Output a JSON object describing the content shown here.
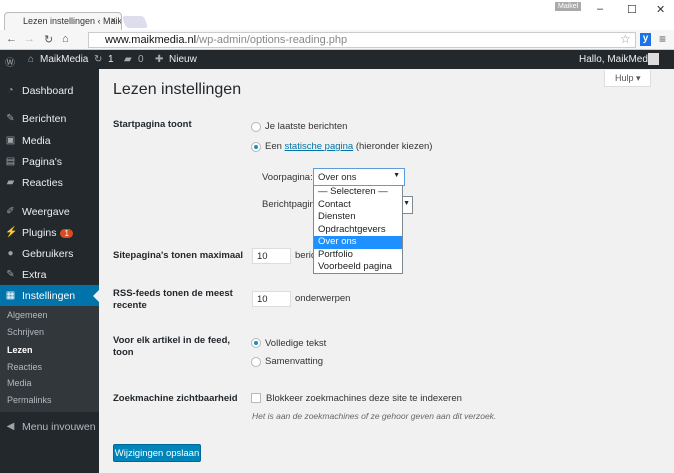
{
  "browser": {
    "tab_title": "Lezen instellingen ‹ Maik",
    "tab_close": "×",
    "profile": "Maikel",
    "url_domain": "www.maikmedia.nl",
    "url_path": "/wp-admin/options-reading.php",
    "ext": "y"
  },
  "adminbar": {
    "site": "MaikMedia",
    "updates": "1",
    "comments": "0",
    "new": "Nieuw",
    "greeting": "Hallo, MaikMedia"
  },
  "sidebar": {
    "items": [
      {
        "label": "Dashboard",
        "icon": "dashboard-icon",
        "glyph": "◔"
      },
      {
        "label": "Berichten",
        "icon": "pin-icon",
        "glyph": "✎"
      },
      {
        "label": "Media",
        "icon": "media-icon",
        "glyph": "▣"
      },
      {
        "label": "Pagina's",
        "icon": "pages-icon",
        "glyph": "▤"
      },
      {
        "label": "Reacties",
        "icon": "comments-icon",
        "glyph": "▰"
      },
      {
        "label": "Weergave",
        "icon": "brush-icon",
        "glyph": "✐"
      },
      {
        "label": "Plugins",
        "icon": "plugin-icon",
        "glyph": "⚡",
        "badge": "1"
      },
      {
        "label": "Gebruikers",
        "icon": "users-icon",
        "glyph": "●"
      },
      {
        "label": "Extra",
        "icon": "tools-icon",
        "glyph": "✎"
      },
      {
        "label": "Instellingen",
        "icon": "settings-icon",
        "glyph": "▦"
      }
    ],
    "submenu": [
      "Algemeen",
      "Schrijven",
      "Lezen",
      "Reacties",
      "Media",
      "Permalinks"
    ],
    "collapse": "Menu invouwen"
  },
  "page": {
    "title": "Lezen instellingen",
    "help": "Hulp ▾",
    "front": {
      "label": "Startpagina toont",
      "opt1": "Je laatste berichten",
      "opt2_pre": "Een ",
      "opt2_link": "statische pagina",
      "opt2_post": " (hieronder kiezen)",
      "front_label": "Voorpagina:",
      "front_value": "Over ons",
      "posts_label": "Berichtpagina:",
      "options": [
        "— Selecteren —",
        "Contact",
        "Diensten",
        "Opdrachtgevers",
        "Over ons",
        "Portfolio",
        "Voorbeeld pagina"
      ]
    },
    "per_page": {
      "label": "Sitepagina's tonen maximaal",
      "value": "10",
      "unit": "berichten"
    },
    "rss": {
      "label": "RSS-feeds tonen de meest recente",
      "value": "10",
      "unit": "onderwerpen"
    },
    "feed": {
      "label": "Voor elk artikel in de feed, toon",
      "opt1": "Volledige tekst",
      "opt2": "Samenvatting"
    },
    "search": {
      "label": "Zoekmachine zichtbaarheid",
      "checkbox": "Blokkeer zoekmachines deze site te indexeren",
      "note": "Het is aan de zoekmachines of ze gehoor geven aan dit verzoek."
    },
    "save": "Wijzigingen opslaan"
  }
}
